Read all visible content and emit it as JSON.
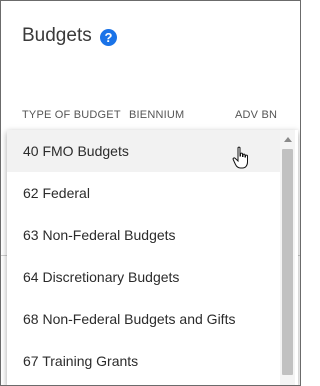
{
  "page": {
    "title": "Budgets",
    "help_icon": "?",
    "columns": [
      "TYPE OF BUDGET",
      "BIENNIUM",
      "ADV BN"
    ]
  },
  "dropdown": {
    "options": [
      "40 FMO Budgets",
      "62 Federal",
      "63 Non-Federal Budgets",
      "64 Discretionary Budgets",
      "68 Non-Federal Budgets and Gifts",
      "67 Training Grants"
    ],
    "hovered_option": "40 FMO Budgets"
  },
  "colors": {
    "accent": "#1a73e8"
  },
  "icons": {
    "help": "help-circle-icon",
    "cursor": "hand-pointer-icon",
    "scroll_up": "chevron-up-icon"
  }
}
